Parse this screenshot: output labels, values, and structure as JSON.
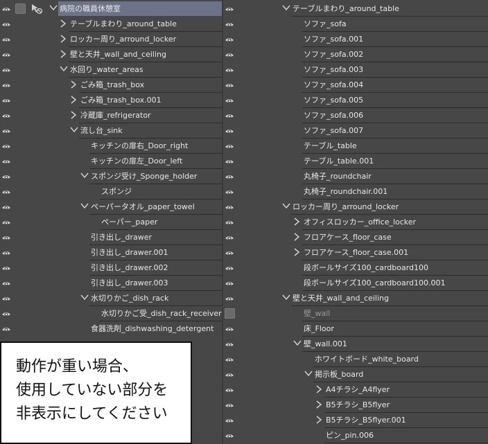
{
  "left_panel": {
    "rows": [
      {
        "label": "病院の職員休憩室",
        "level": 0,
        "state": "expanded",
        "visible": true,
        "selected": true,
        "root": true
      },
      {
        "label": "テーブルまわり_around_table",
        "level": 1,
        "state": "collapsed",
        "visible": true
      },
      {
        "label": "ロッカー周り_arround_locker",
        "level": 1,
        "state": "collapsed",
        "visible": true
      },
      {
        "label": "壁と天井_wall_and_ceiling",
        "level": 1,
        "state": "collapsed",
        "visible": true
      },
      {
        "label": "水回り_water_areas",
        "level": 1,
        "state": "expanded",
        "visible": true
      },
      {
        "label": "ごみ箱_trash_box",
        "level": 2,
        "state": "collapsed",
        "visible": true
      },
      {
        "label": "ごみ箱_trash_box.001",
        "level": 2,
        "state": "collapsed",
        "visible": true
      },
      {
        "label": "冷蔵庫_refrigerator",
        "level": 2,
        "state": "collapsed",
        "visible": true
      },
      {
        "label": "流し台_sink",
        "level": 2,
        "state": "expanded",
        "visible": true
      },
      {
        "label": "キッチンの扉右_Door_right",
        "level": 3,
        "state": "leaf",
        "visible": true
      },
      {
        "label": "キッチンの扉左_Door_left",
        "level": 3,
        "state": "leaf",
        "visible": true
      },
      {
        "label": "スポンジ受け_Sponge_holder",
        "level": 3,
        "state": "expanded",
        "visible": true
      },
      {
        "label": "スポンジ",
        "level": 4,
        "state": "leaf",
        "visible": true
      },
      {
        "label": "ペーパータオル_paper_towel",
        "level": 3,
        "state": "expanded",
        "visible": true
      },
      {
        "label": "ペーパー_paper",
        "level": 4,
        "state": "leaf",
        "visible": true
      },
      {
        "label": "引き出し_drawer",
        "level": 3,
        "state": "leaf",
        "visible": true
      },
      {
        "label": "引き出し_drawer.001",
        "level": 3,
        "state": "leaf",
        "visible": true
      },
      {
        "label": "引き出し_drawer.002",
        "level": 3,
        "state": "leaf",
        "visible": true
      },
      {
        "label": "引き出し_drawer.003",
        "level": 3,
        "state": "leaf",
        "visible": true
      },
      {
        "label": "水切りかご_dish_rack",
        "level": 3,
        "state": "expanded",
        "visible": true
      },
      {
        "label": "水切りかご受_dish_rack_receiver",
        "level": 4,
        "state": "leaf",
        "visible": true
      },
      {
        "label": "食器洗剤_dishwashing_detergent",
        "level": 3,
        "state": "leaf",
        "visible": true,
        "last": true
      }
    ]
  },
  "right_panel": {
    "rows": [
      {
        "label": "テーブルまわり_around_table",
        "level": 0,
        "state": "expanded",
        "visible": true
      },
      {
        "label": "ソファ_sofa",
        "level": 1,
        "state": "leaf",
        "visible": true
      },
      {
        "label": "ソファ_sofa.001",
        "level": 1,
        "state": "leaf",
        "visible": true
      },
      {
        "label": "ソファ_sofa.002",
        "level": 1,
        "state": "leaf",
        "visible": true
      },
      {
        "label": "ソファ_sofa.003",
        "level": 1,
        "state": "leaf",
        "visible": true
      },
      {
        "label": "ソファ_sofa.004",
        "level": 1,
        "state": "leaf",
        "visible": true
      },
      {
        "label": "ソファ_sofa.005",
        "level": 1,
        "state": "leaf",
        "visible": true
      },
      {
        "label": "ソファ_sofa.006",
        "level": 1,
        "state": "leaf",
        "visible": true
      },
      {
        "label": "ソファ_sofa.007",
        "level": 1,
        "state": "leaf",
        "visible": true
      },
      {
        "label": "テーブル_table",
        "level": 1,
        "state": "leaf",
        "visible": true
      },
      {
        "label": "テーブル_table.001",
        "level": 1,
        "state": "leaf",
        "visible": true
      },
      {
        "label": "丸椅子_roundchair",
        "level": 1,
        "state": "leaf",
        "visible": true
      },
      {
        "label": "丸椅子_roundchair.001",
        "level": 1,
        "state": "leaf",
        "visible": true
      },
      {
        "label": "ロッカー周り_arround_locker",
        "level": 0,
        "state": "expanded",
        "visible": true
      },
      {
        "label": "オフィスロッカー_office_locker",
        "level": 1,
        "state": "collapsed",
        "visible": true
      },
      {
        "label": "フロアケース_floor_case",
        "level": 1,
        "state": "collapsed",
        "visible": true
      },
      {
        "label": "フロアケース_floor_case.001",
        "level": 1,
        "state": "collapsed",
        "visible": true
      },
      {
        "label": "段ボールサイズ100_cardboard100",
        "level": 1,
        "state": "leaf",
        "visible": true
      },
      {
        "label": "段ボールサイズ100_cardboard100.001",
        "level": 1,
        "state": "leaf",
        "visible": true
      },
      {
        "label": "壁と天井_wall_and_ceiling",
        "level": 0,
        "state": "expanded",
        "visible": true
      },
      {
        "label": "壁_wall",
        "level": 1,
        "state": "leaf",
        "visible": false
      },
      {
        "label": "床_Floor",
        "level": 1,
        "state": "leaf",
        "visible": true
      },
      {
        "label": "壁_wall.001",
        "level": 1,
        "state": "expanded",
        "visible": true
      },
      {
        "label": "ホワイトボード_white_board",
        "level": 2,
        "state": "leaf",
        "visible": true
      },
      {
        "label": "掲示板_board",
        "level": 2,
        "state": "expanded",
        "visible": true
      },
      {
        "label": "A4チラシ_A4flyer",
        "level": 3,
        "state": "collapsed",
        "visible": true
      },
      {
        "label": "B5チラシ_B5flyer",
        "level": 3,
        "state": "collapsed",
        "visible": true
      },
      {
        "label": "B5チラシ_B5flyer.001",
        "level": 3,
        "state": "collapsed",
        "visible": true
      },
      {
        "label": "ピン_pin.006",
        "level": 3,
        "state": "leaf",
        "visible": true
      }
    ]
  },
  "note": {
    "lines": [
      "動作が重い場合、",
      "使用していない部分を",
      "非表示にしてください"
    ]
  },
  "colors": {
    "background": "#474747",
    "selected": "#6c7388",
    "note_bg": "#ffffff"
  }
}
